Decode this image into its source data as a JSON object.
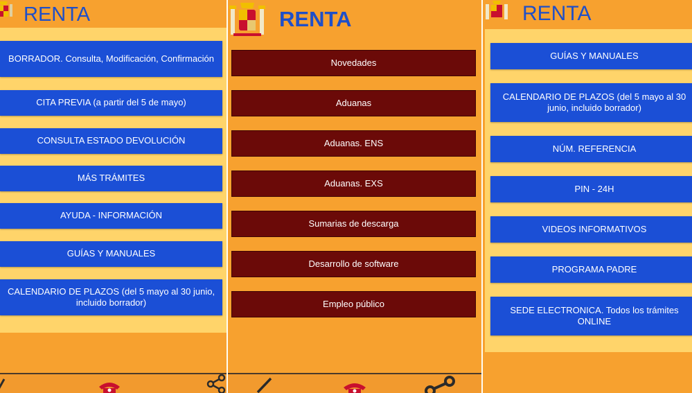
{
  "panels": [
    {
      "title": "RENTA",
      "buttons": [
        "BORRADOR. Consulta, Modificación, Confirmación",
        "CITA PREVIA (a partir del 5 de mayo)",
        "CONSULTA ESTADO DEVOLUCIÓN",
        "MÁS TRÁMITES",
        "AYUDA - INFORMACIÓN",
        "GUÍAS Y MANUALES",
        "CALENDARIO DE PLAZOS (del 5 mayo al 30 junio, incluido borrador)"
      ]
    },
    {
      "title": "RENTA",
      "buttons": [
        "Novedades",
        "Aduanas",
        "Aduanas. ENS",
        "Aduanas. EXS",
        "Sumarias de descarga",
        "Desarrollo de software",
        "Empleo público"
      ]
    },
    {
      "title": "RENTA",
      "buttons": [
        "GUÍAS Y MANUALES",
        "CALENDARIO DE PLAZOS (del 5 mayo al 30 junio, incluido borrador)",
        "NÚM. REFERENCIA",
        "PIN - 24H",
        "VIDEOS INFORMATIVOS",
        "PROGRAMA PADRE",
        "SEDE ELECTRONICA. Todos los trámites ONLINE"
      ]
    }
  ],
  "icons": {
    "edit": "pencil-icon",
    "phone": "telephone-icon",
    "share": "share-icon"
  },
  "colors": {
    "background": "#f7a12f",
    "title": "#1f4fc8",
    "blue_button": "#1b4fd6",
    "red_button": "#6b0a08",
    "yellow_band": "#ffd46a"
  }
}
